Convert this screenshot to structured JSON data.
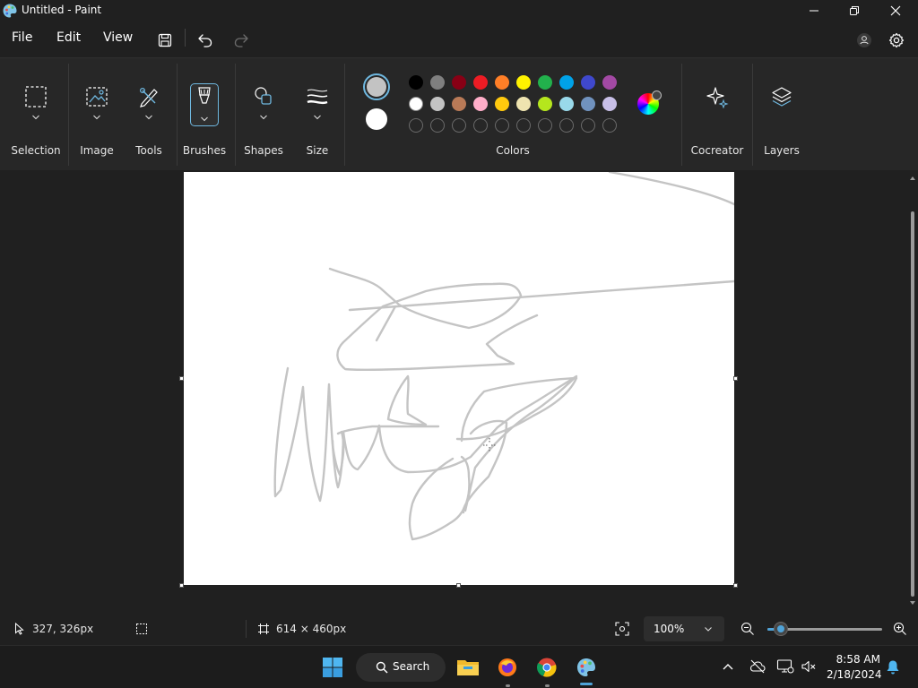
{
  "window": {
    "title": "Untitled - Paint"
  },
  "menu": {
    "file": "File",
    "edit": "Edit",
    "view": "View"
  },
  "ribbon": {
    "groups": {
      "selection": "Selection",
      "image": "Image",
      "tools": "Tools",
      "brushes": "Brushes",
      "shapes": "Shapes",
      "size": "Size",
      "colors": "Colors",
      "cocreator": "Cocreator",
      "layers": "Layers"
    },
    "primary_color": "#c3c3c3",
    "secondary_color": "#ffffff",
    "palette_row1": [
      "#000000",
      "#7f7f7f",
      "#880015",
      "#ed1c24",
      "#ff7f27",
      "#fff200",
      "#22b14c",
      "#00a2e8",
      "#3f48cc",
      "#a349a4"
    ],
    "palette_row2": [
      "#ffffff",
      "#c3c3c3",
      "#b97a57",
      "#ffaec9",
      "#ffc90e",
      "#efe4b0",
      "#b5e61d",
      "#99d9ea",
      "#7092be",
      "#c8bfe7"
    ],
    "palette_row3_empty_count": 10,
    "accent": "#6fb8e0"
  },
  "status": {
    "cursor_position": "327, 326px",
    "canvas_size": "614 × 460px",
    "zoom": "100%",
    "zoom_fraction": 0.12
  },
  "taskbar": {
    "search_label": "Search",
    "time": "8:58 AM",
    "date": "2/18/2024"
  }
}
